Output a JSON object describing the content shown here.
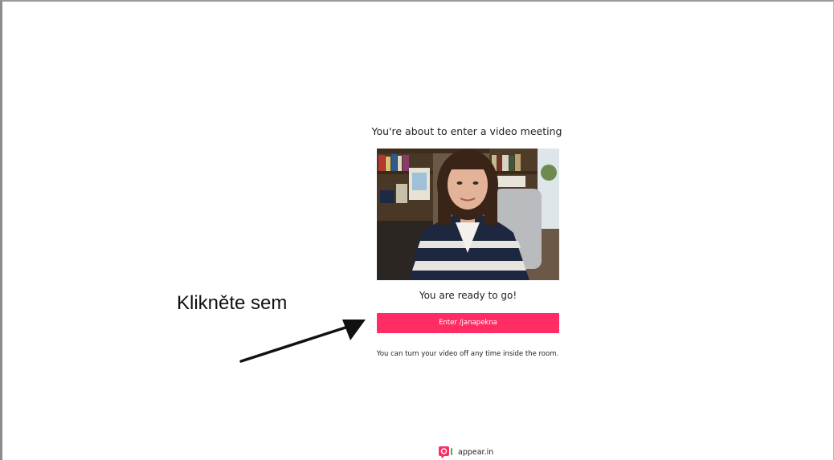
{
  "prejoin": {
    "title": "You're about to enter a video meeting",
    "ready_text": "You are ready to go!",
    "enter_button_label": "Enter /janapekna",
    "video_note": "You can turn your video off any time inside the room."
  },
  "annotation": {
    "text": "Klikněte sem"
  },
  "footer": {
    "logo_text": "appear.in"
  },
  "colors": {
    "accent": "#ff2d64",
    "logo_green": "#37b55a"
  },
  "icons": {
    "camera_preview": "webcam-video-preview",
    "logo": "appear-in-logo-icon",
    "annotation_arrow": "arrow-pointer-icon"
  }
}
